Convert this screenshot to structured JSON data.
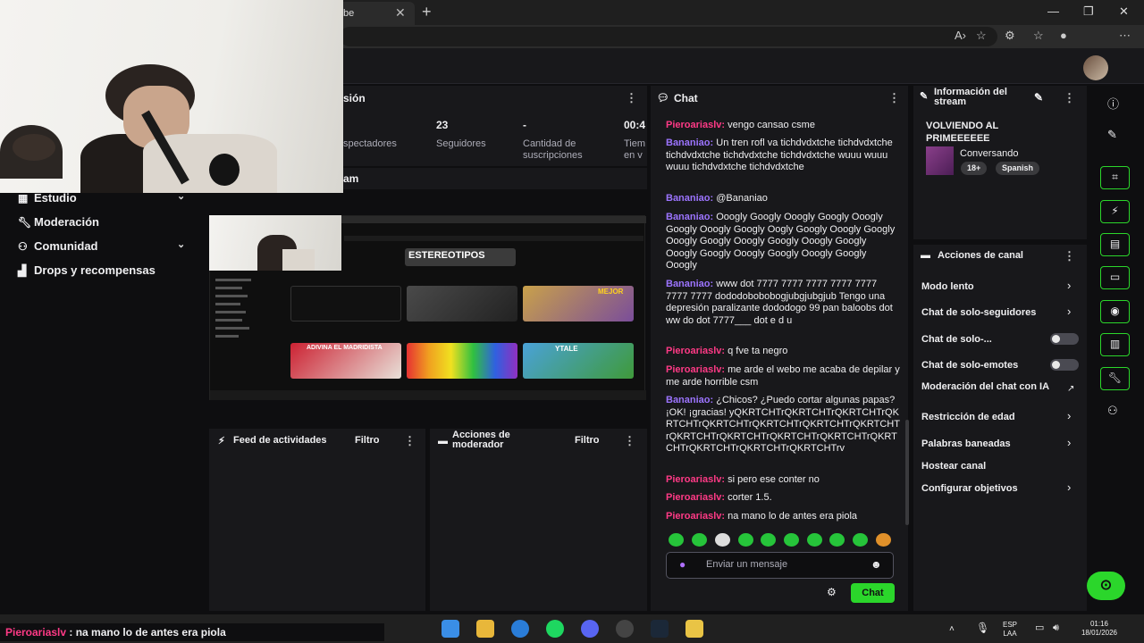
{
  "browser": {
    "tab_title": "be",
    "tab_close": "✕",
    "new_tab": "+",
    "window_controls": [
      "—",
      "❐",
      "✕"
    ]
  },
  "left_nav": {
    "items": [
      {
        "label": "Estudio",
        "icon": "studio-icon",
        "expandable": true
      },
      {
        "label": "Moderación",
        "icon": "wrench-icon",
        "expandable": false
      },
      {
        "label": "Comunidad",
        "icon": "community-icon",
        "expandable": true
      },
      {
        "label": "Drops y recompensas",
        "icon": "drops-icon",
        "expandable": false
      }
    ]
  },
  "session_panel": {
    "title_partial": "sión",
    "stats": [
      {
        "value": "",
        "label": "spectadores"
      },
      {
        "value": "23",
        "label": "Seguidores"
      },
      {
        "value": "-",
        "label": "Cantidad de suscripciones"
      },
      {
        "value": "00:4",
        "label": "Tiem en v"
      }
    ]
  },
  "preview_panel": {
    "title_partial": "am",
    "nested_video_titles": [
      "ESTEREOTIPOS",
      "ADIVINA EL MADRIDISTA",
      "MEJOR",
      "YTALE"
    ]
  },
  "activity_feed": {
    "title": "Feed de actividades",
    "filter": "Filtro"
  },
  "mod_actions": {
    "title": "Acciones de moderador",
    "filter": "Filtro"
  },
  "chat": {
    "title": "Chat",
    "messages": [
      {
        "user": "Pieroariaslv",
        "color": "pink",
        "text": "vengo cansao csme"
      },
      {
        "user": "Bananiao",
        "color": "purple",
        "text": "Un tren rofl va tichdvdxtche tichdvdxtche tichdvdxtche tichdvdxtche tichdvdxtche wuuu wuuu wuuu tichdvdxtche tichdvdxtche"
      },
      {
        "user": "Bananiao",
        "color": "purple",
        "text": "@Bananiao"
      },
      {
        "user": "Bananiao",
        "color": "purple",
        "text": "Ooogly Googly Ooogly Googly Ooogly Googly Ooogly Googly Oogly Googly Ooogly Googly Ooogly Googly Ooogly Googly Ooogly Googly Ooogly Googly Ooogly Googly Ooogly Googly Ooogly"
      },
      {
        "user": "Bananiao",
        "color": "purple",
        "text": "www dot 7777 7777 7777 7777 7777 7777 7777 dododobobobogjubgjubgjub Tengo una depresión paralizante dododogo 99 pan baloobs dot ww do dot 7777___ dot e d u"
      },
      {
        "user": "Pieroariaslv",
        "color": "pink",
        "text": "q fve ta negro"
      },
      {
        "user": "Pieroariaslv",
        "color": "pink",
        "text": "me arde el webo me acaba de depilar y me arde horrible csm"
      },
      {
        "user": "Bananiao",
        "color": "purple",
        "text": "¿Chicos? ¿Puedo cortar algunas papas? ¡OK! ¡gracias! yQKRTCHTrQKRTCHTrQKRTCHTrQKRTCHTrQKRTCHTrQKRTCHTrQKRTCHTrQKRTCHTrQKRTCHTrQKRTCHTrQKRTCHTrQKRTCHTrQKRTCHTrQKRTCHTrQKRTCHTrQKRTCHTrv"
      },
      {
        "user": "Pieroariaslv",
        "color": "pink",
        "text": "si pero ese conter no"
      },
      {
        "user": "Pieroariaslv",
        "color": "pink",
        "text": "corter 1.5."
      },
      {
        "user": "Pieroariaslv",
        "color": "pink",
        "text": "na mano lo de antes era piola"
      }
    ],
    "input_placeholder": "Enviar un mensaje",
    "send_button": "Chat"
  },
  "stream_info": {
    "title": "Información del stream",
    "stream_title": "VOLVIENDO AL PRIMEEEEEE",
    "category": "Conversando",
    "tags": [
      "18+",
      "Spanish"
    ]
  },
  "channel_actions": {
    "title": "Acciones de canal",
    "items": [
      {
        "label": "Modo lento",
        "control": "chevron"
      },
      {
        "label": "Chat de solo-seguidores",
        "control": "chevron"
      },
      {
        "label": "Chat de solo-...",
        "control": "toggle",
        "on": false
      },
      {
        "label": "Chat de solo-emotes",
        "control": "toggle",
        "on": false
      },
      {
        "label": "Moderación del chat con IA",
        "control": "external"
      },
      {
        "label": "Restricción de edad",
        "control": "chevron"
      },
      {
        "label": "Palabras baneadas",
        "control": "chevron"
      },
      {
        "label": "Hostear canal",
        "control": "none"
      },
      {
        "label": "Configurar objetivos",
        "control": "chevron"
      }
    ]
  },
  "ticker": {
    "user": "Pieroariaslv",
    "text": " : na mano lo de antes era piola"
  },
  "taskbar": {
    "lang_top": "ESP",
    "lang_bottom": "LAA",
    "time": "01:16",
    "date": "18/01/2026"
  },
  "colors": {
    "accent": "#2bd62b",
    "user_pink": "#ff3a86",
    "user_purple": "#9c74ff",
    "panel_bg": "#18181b"
  }
}
